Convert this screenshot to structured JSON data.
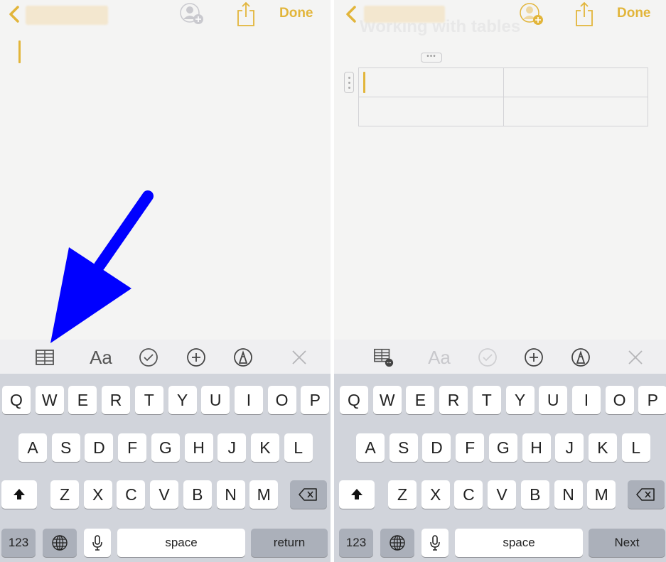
{
  "left_screen": {
    "nav": {
      "back_label": "",
      "done_label": "Done"
    },
    "toolbar": {
      "items": [
        {
          "icon": "table-icon",
          "state": "active"
        },
        {
          "label": "Aa",
          "icon": "format-text-icon",
          "state": "active"
        },
        {
          "icon": "checklist-icon",
          "state": "active"
        },
        {
          "icon": "add-circle-icon",
          "state": "active"
        },
        {
          "icon": "markup-pen-icon",
          "state": "active"
        },
        {
          "icon": "close-icon",
          "state": "dim"
        }
      ]
    },
    "keyboard": {
      "row1": [
        "Q",
        "W",
        "E",
        "R",
        "T",
        "Y",
        "U",
        "I",
        "O",
        "P"
      ],
      "row2": [
        "A",
        "S",
        "D",
        "F",
        "G",
        "H",
        "J",
        "K",
        "L"
      ],
      "row3": [
        "Z",
        "X",
        "C",
        "V",
        "B",
        "N",
        "M"
      ],
      "numbers_label": "123",
      "space_label": "space",
      "action_label": "return"
    },
    "annotation": {
      "type": "arrow",
      "color": "#0000ff",
      "points_to": "table-button"
    }
  },
  "right_screen": {
    "nav": {
      "back_label": "",
      "done_label": "Done"
    },
    "note_title": "Working with tables",
    "table": {
      "rows": 2,
      "cols": 2,
      "cells": [
        [
          "",
          ""
        ],
        [
          "",
          ""
        ]
      ],
      "column_handle": "•••"
    },
    "toolbar": {
      "items": [
        {
          "icon": "table-options-icon",
          "state": "active"
        },
        {
          "label": "Aa",
          "icon": "format-text-icon",
          "state": "disabled"
        },
        {
          "icon": "checklist-icon",
          "state": "disabled"
        },
        {
          "icon": "add-circle-icon",
          "state": "active"
        },
        {
          "icon": "markup-pen-icon",
          "state": "active"
        },
        {
          "icon": "close-icon",
          "state": "dim"
        }
      ]
    },
    "keyboard": {
      "row1": [
        "Q",
        "W",
        "E",
        "R",
        "T",
        "Y",
        "U",
        "I",
        "O",
        "P"
      ],
      "row2": [
        "A",
        "S",
        "D",
        "F",
        "G",
        "H",
        "J",
        "K",
        "L"
      ],
      "row3": [
        "Z",
        "X",
        "C",
        "V",
        "B",
        "N",
        "M"
      ],
      "numbers_label": "123",
      "space_label": "space",
      "action_label": "Next"
    }
  },
  "colors": {
    "accent": "#e2b53a",
    "keyboard_bg": "#d1d4db",
    "function_key": "#abb0ba",
    "annotation": "#0000ff"
  }
}
